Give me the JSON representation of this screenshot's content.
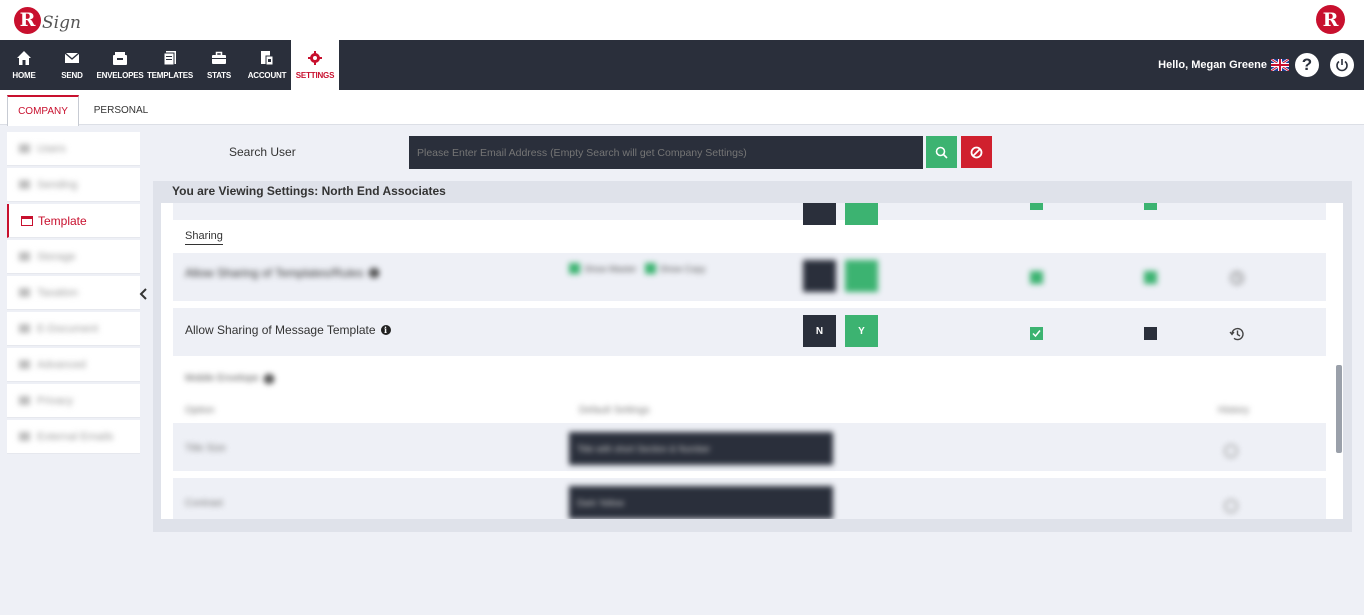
{
  "brand": {
    "logo_letter": "R",
    "logo_script": "Sign",
    "logo_right_letter": "R"
  },
  "nav": {
    "items": [
      {
        "label": "HOME",
        "icon": "home-icon"
      },
      {
        "label": "SEND",
        "icon": "envelope-icon"
      },
      {
        "label": "ENVELOPES",
        "icon": "envelopes-icon"
      },
      {
        "label": "TEMPLATES",
        "icon": "templates-icon"
      },
      {
        "label": "STATS",
        "icon": "briefcase-icon"
      },
      {
        "label": "ACCOUNT",
        "icon": "account-icon"
      },
      {
        "label": "SETTINGS",
        "icon": "gear-icon"
      }
    ],
    "greeting": "Hello,",
    "user_name": "Megan Greene",
    "help_symbol": "?",
    "accent_color": "#c8102e",
    "bar_color": "#2a2f3b"
  },
  "tabs": [
    {
      "label": "COMPANY",
      "active": true
    },
    {
      "label": "PERSONAL",
      "active": false
    }
  ],
  "sidebar": {
    "items": [
      {
        "label": "Users",
        "blurred": true
      },
      {
        "label": "Sending",
        "blurred": true
      },
      {
        "label": "Template",
        "blurred": false,
        "active": true
      },
      {
        "label": "Storage",
        "blurred": true
      },
      {
        "label": "Taxation",
        "blurred": true
      },
      {
        "label": "E-Document",
        "blurred": true
      },
      {
        "label": "Advanced",
        "blurred": true
      },
      {
        "label": "Privacy",
        "blurred": true
      },
      {
        "label": "External Emails",
        "blurred": true
      }
    ]
  },
  "search": {
    "label": "Search User",
    "placeholder": "Please Enter Email Address (Empty Search will get Company Settings)"
  },
  "panel": {
    "title": "You are Viewing Settings: North End Associates",
    "section_sharing": "Sharing",
    "row_blurred_label": "Allow Sharing of Templates/Rules",
    "row_blurred_opts": [
      "Show Master",
      "Show Copy"
    ],
    "row_message_label": "Allow Sharing of Message Template",
    "btn_n": "N",
    "btn_y": "Y",
    "blurred_section": "Mobile Envelope",
    "blurred_headers": [
      "Option",
      "Default Settings",
      "History"
    ],
    "blurred_rows": [
      {
        "label": "Title Size",
        "value": "Title with short Section & Number"
      },
      {
        "label": "Contrast",
        "value": "Dark Yellow"
      }
    ]
  }
}
